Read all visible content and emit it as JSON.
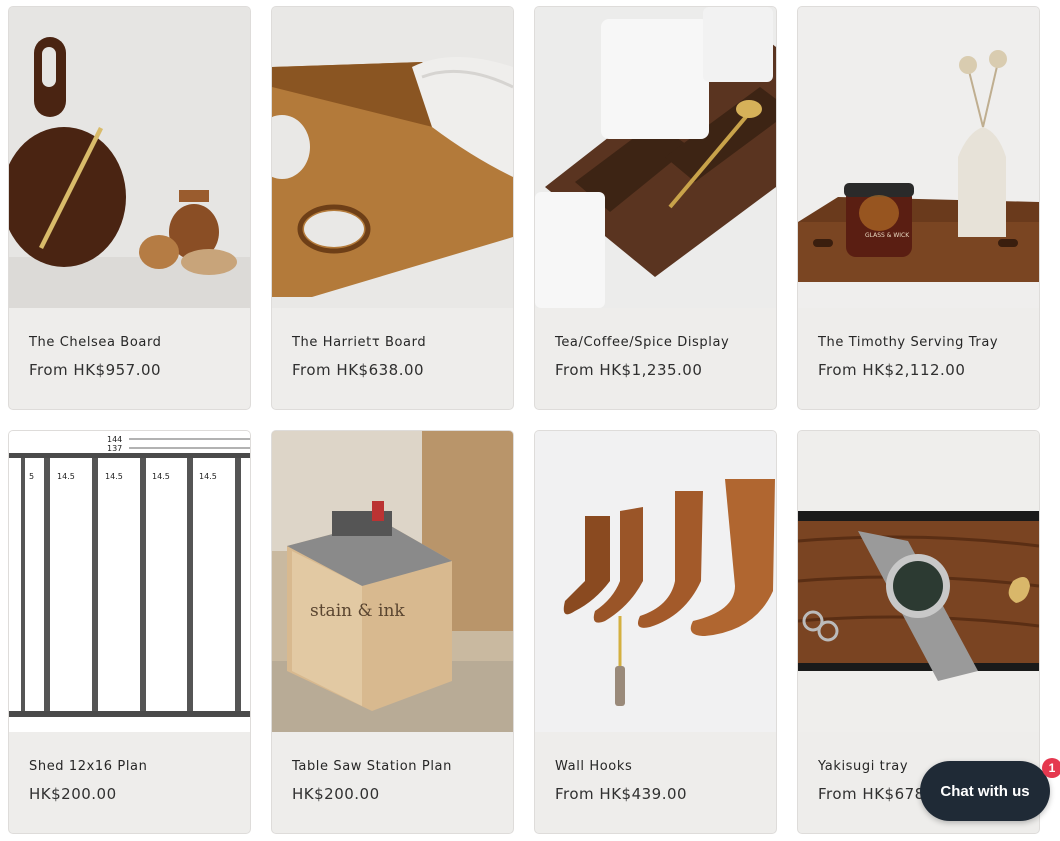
{
  "products": [
    {
      "title": "The Chelsea Board",
      "price": "From HK$957.00"
    },
    {
      "title": "The Harrietτ Board",
      "price": "From HK$638.00"
    },
    {
      "title": "Tea/Coffee/Spice Display",
      "price": "From HK$1,235.00"
    },
    {
      "title": "The Timothy Serving Tray",
      "price": "From HK$2,112.00"
    },
    {
      "title": "Shed 12x16 Plan",
      "price": "HK$200.00"
    },
    {
      "title": "Table Saw Station Plan",
      "price": "HK$200.00"
    },
    {
      "title": "Wall Hooks",
      "price": "From HK$439.00"
    },
    {
      "title": "Yakisugi tray",
      "price": "From HK$678"
    }
  ],
  "plan_labels": {
    "top1": "144",
    "top2": "137",
    "col1": "5",
    "col2": "14.5",
    "col3": "14.5",
    "col4": "14.5",
    "col5": "14.5"
  },
  "box_brand": "stain & ink",
  "candle_label": "GLASS & WICK",
  "chat": {
    "label": "Chat with us",
    "badge": "1"
  },
  "colors": {
    "card_bg": "#eeedeb",
    "chat_bg": "#1f2a36",
    "badge": "#e5384f"
  }
}
